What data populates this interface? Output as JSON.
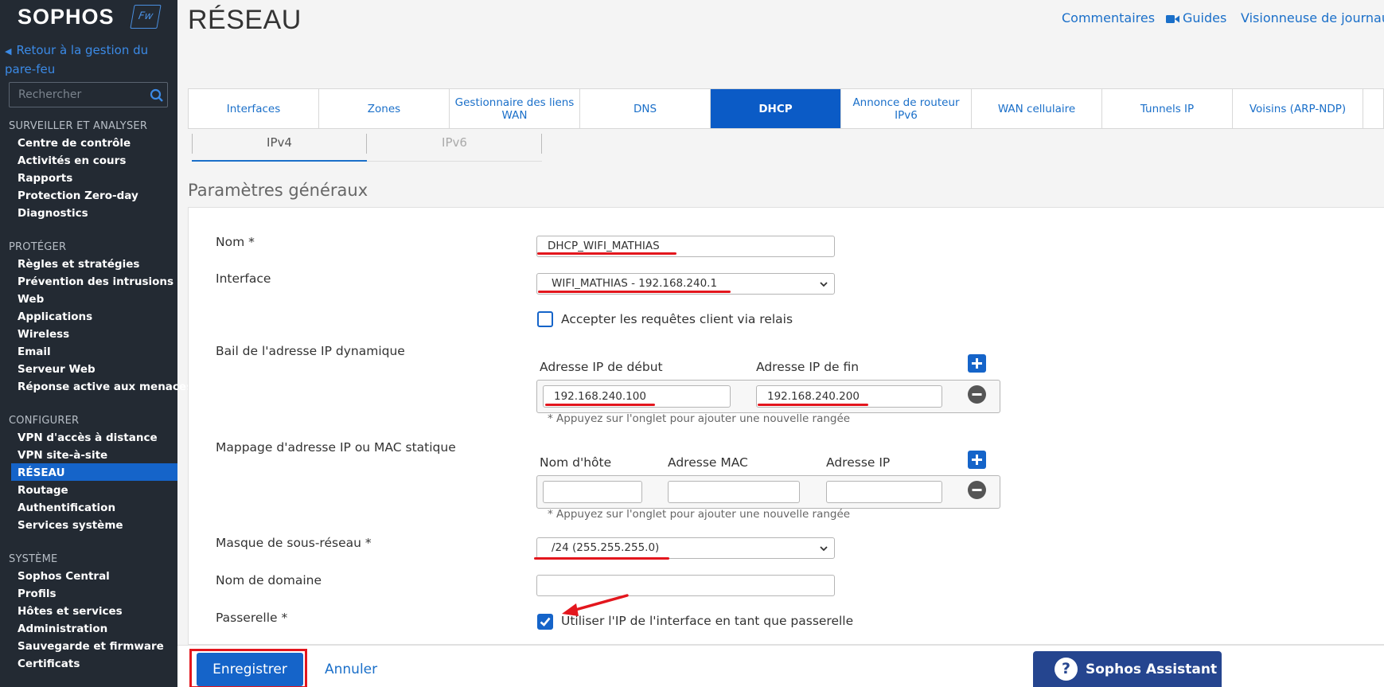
{
  "sidebar": {
    "logo": "SOPHOS",
    "logo_badge": "Fw",
    "back_link": "Retour à la gestion du pare-feu",
    "search_placeholder": "Rechercher",
    "sections": [
      {
        "title": "SURVEILLER ET ANALYSER",
        "items": [
          "Centre de contrôle",
          "Activités en cours",
          "Rapports",
          "Protection Zero-day",
          "Diagnostics"
        ]
      },
      {
        "title": "PROTÉGER",
        "items": [
          "Règles et stratégies",
          "Prévention des intrusions",
          "Web",
          "Applications",
          "Wireless",
          "Email",
          "Serveur Web",
          "Réponse active aux menaces"
        ]
      },
      {
        "title": "CONFIGURER",
        "items": [
          "VPN d'accès à distance",
          "VPN site-à-site",
          "RÉSEAU",
          "Routage",
          "Authentification",
          "Services système"
        ]
      },
      {
        "title": "SYSTÈME",
        "items": [
          "Sophos Central",
          "Profils",
          "Hôtes et services",
          "Administration",
          "Sauvegarde et firmware",
          "Certificats"
        ]
      }
    ],
    "active_item": "RÉSEAU"
  },
  "header": {
    "title": "RÉSEAU",
    "links": [
      "Commentaires",
      "Guides",
      "Visionneuse de journaux"
    ]
  },
  "tabs": [
    "Interfaces",
    "Zones",
    "Gestionnaire des liens WAN",
    "DNS",
    "DHCP",
    "Annonce de routeur IPv6",
    "WAN cellulaire",
    "Tunnels IP",
    "Voisins (ARP-NDP)"
  ],
  "active_tab": "DHCP",
  "subtabs": [
    "IPv4",
    "IPv6"
  ],
  "section_title": "Paramètres généraux",
  "form": {
    "name_label": "Nom *",
    "name_value": "DHCP_WIFI_MATHIAS",
    "interface_label": "Interface",
    "interface_value": "WIFI_MATHIAS - 192.168.240.1",
    "relay_label": "Accepter les requêtes client via relais",
    "relay_checked": false,
    "lease_label": "Bail de l'adresse IP dynamique",
    "lease_col_start": "Adresse IP de début",
    "lease_col_end": "Adresse IP de fin",
    "lease_start": "192.168.240.100",
    "lease_end": "192.168.240.200",
    "lease_hint": "* Appuyez sur l'onglet pour ajouter une nouvelle rangée",
    "static_label": "Mappage d'adresse IP ou MAC statique",
    "static_col_host": "Nom d'hôte",
    "static_col_mac": "Adresse MAC",
    "static_col_ip": "Adresse IP",
    "static_hint": "* Appuyez sur l'onglet pour ajouter une nouvelle rangée",
    "mask_label": "Masque de sous-réseau *",
    "mask_value": "/24 (255.255.255.0)",
    "domain_label": "Nom de domaine",
    "domain_value": "",
    "gateway_label": "Passerelle *",
    "gateway_checkbox_label": "Utiliser l'IP de l'interface en tant que passerelle",
    "gateway_checked": true
  },
  "buttons": {
    "save": "Enregistrer",
    "cancel": "Annuler",
    "assistant": "Sophos Assistant"
  },
  "colors": {
    "accent": "#1564c9",
    "annotation_red": "#e3161d",
    "sidebar_bg": "#232a33"
  }
}
